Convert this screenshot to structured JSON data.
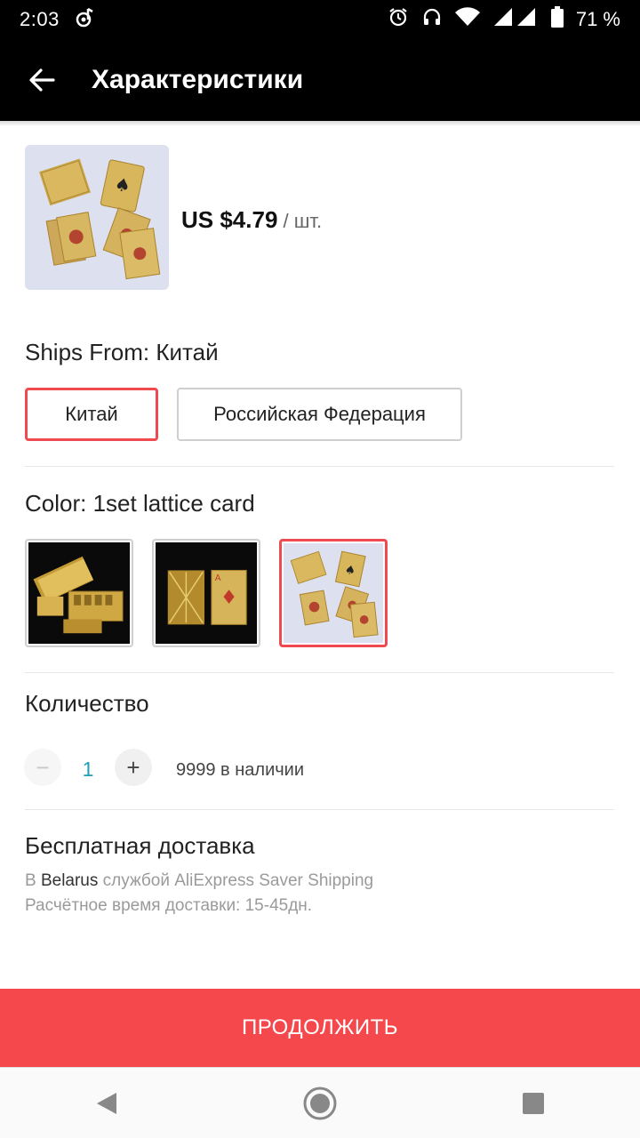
{
  "status_bar": {
    "time": "2:03",
    "battery": "71 %"
  },
  "app_bar": {
    "title": "Характеристики"
  },
  "product": {
    "price": "US $4.79",
    "unit": " / шт."
  },
  "ships_from": {
    "label": "Ships From: Китай",
    "options": [
      {
        "label": "Китай",
        "selected": true
      },
      {
        "label": "Российская Федерация",
        "selected": false
      }
    ]
  },
  "color": {
    "label": "Color: 1set lattice card",
    "swatches": [
      {
        "name": "gold-cards-fan-dark",
        "selected": false
      },
      {
        "name": "gold-cards-two-dark",
        "selected": false
      },
      {
        "name": "lattice-cards-light",
        "selected": true
      }
    ]
  },
  "quantity": {
    "label": "Количество",
    "minus": "−",
    "value": "1",
    "plus": "+",
    "stock": "9999 в наличии"
  },
  "shipping": {
    "title": "Бесплатная доставка",
    "line1_prefix": "В ",
    "line1_country": "Belarus",
    "line1_suffix": " службой AliExpress Saver Shipping",
    "line2": "Расчётное время доставки: 15-45дн."
  },
  "continue_button": {
    "label": "ПРОДОЛЖИТЬ"
  },
  "icons": {
    "status": [
      "music-note-icon",
      "alarm-icon",
      "headphones-icon",
      "wifi-icon",
      "signal-icon",
      "battery-icon"
    ],
    "nav": [
      "nav-back-icon",
      "nav-home-icon",
      "nav-recents-icon"
    ]
  }
}
